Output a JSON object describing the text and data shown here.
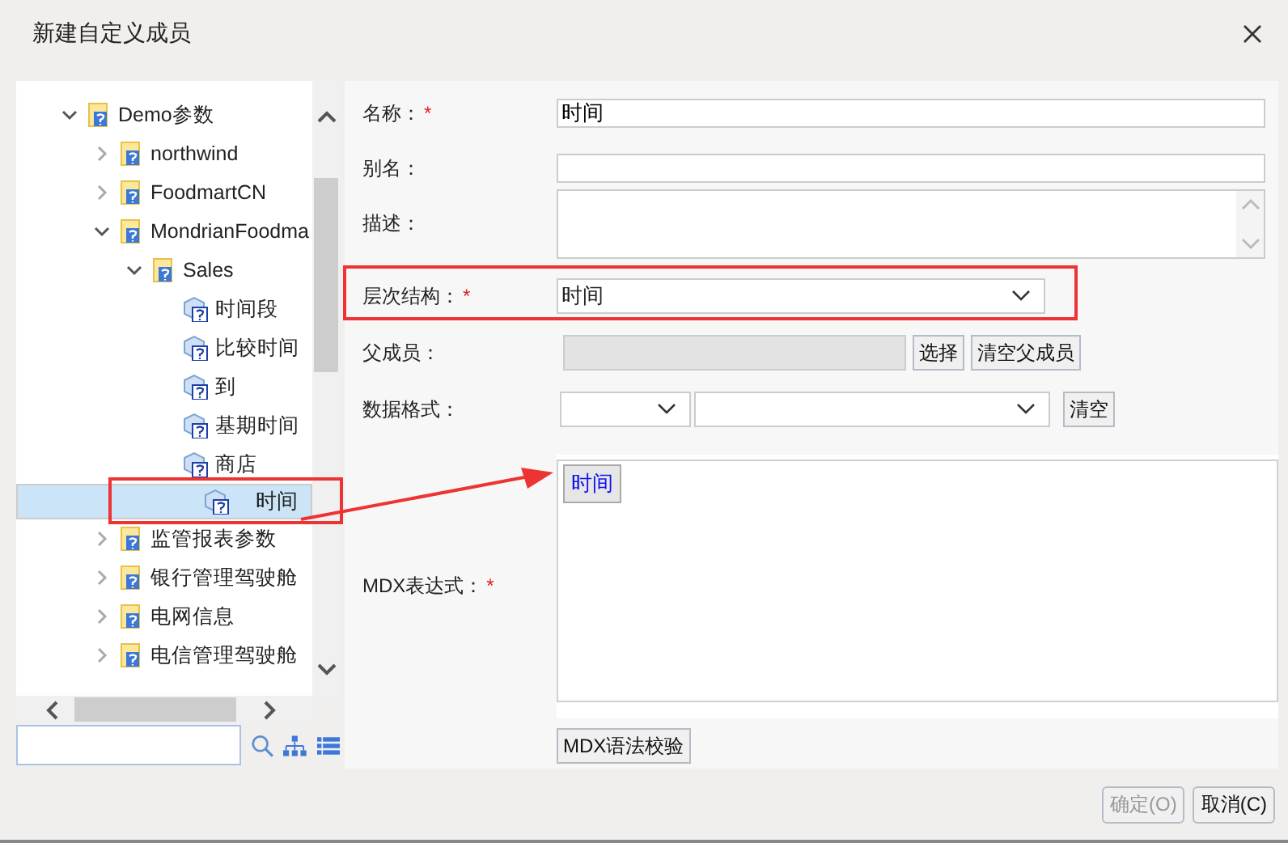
{
  "window": {
    "title": "新建自定义成员"
  },
  "tree": [
    {
      "label": "Demo参数",
      "kind": "folder",
      "expanded": true,
      "selected": false,
      "children": [
        {
          "label": "northwind",
          "kind": "folder",
          "expanded": false,
          "selected": false
        },
        {
          "label": "FoodmartCN",
          "kind": "folder",
          "expanded": false,
          "selected": false
        },
        {
          "label": "MondrianFoodma",
          "kind": "folder",
          "expanded": true,
          "selected": false,
          "children": [
            {
              "label": "Sales",
              "kind": "folder",
              "expanded": true,
              "selected": false,
              "children": [
                {
                  "label": "时间段",
                  "kind": "cube",
                  "selected": false
                },
                {
                  "label": "比较时间",
                  "kind": "cube",
                  "selected": false
                },
                {
                  "label": "到",
                  "kind": "cube",
                  "selected": false
                },
                {
                  "label": "基期时间",
                  "kind": "cube",
                  "selected": false
                },
                {
                  "label": "商店",
                  "kind": "cube",
                  "selected": false
                },
                {
                  "label": "时间",
                  "kind": "cube",
                  "selected": true
                }
              ]
            }
          ]
        },
        {
          "label": "监管报表参数",
          "kind": "folder",
          "expanded": false,
          "selected": false
        },
        {
          "label": "银行管理驾驶舱",
          "kind": "folder",
          "expanded": false,
          "selected": false
        },
        {
          "label": "电网信息",
          "kind": "folder",
          "expanded": false,
          "selected": false
        },
        {
          "label": "电信管理驾驶舱",
          "kind": "folder",
          "expanded": false,
          "selected": false
        }
      ]
    }
  ],
  "form": {
    "name": {
      "label": "名称：",
      "required_mark": "*",
      "value": "时间"
    },
    "alias": {
      "label": "别名："
    },
    "description": {
      "label": "描述："
    },
    "hierarchy": {
      "label": "层次结构：",
      "required_mark": "*",
      "value": "时间"
    },
    "parent": {
      "label": "父成员：",
      "buttons": [
        "选择",
        "清空父成员"
      ]
    },
    "format": {
      "label": "数据格式：",
      "button": "清空"
    },
    "mdx": {
      "label": "MDX表达式：",
      "required_mark": "*",
      "tokens": [
        "时间"
      ],
      "button": "MDX语法校验"
    }
  },
  "footer": [
    {
      "label": "确定(O)",
      "disabled": true
    },
    {
      "label": "取消(C)",
      "disabled": false
    }
  ]
}
